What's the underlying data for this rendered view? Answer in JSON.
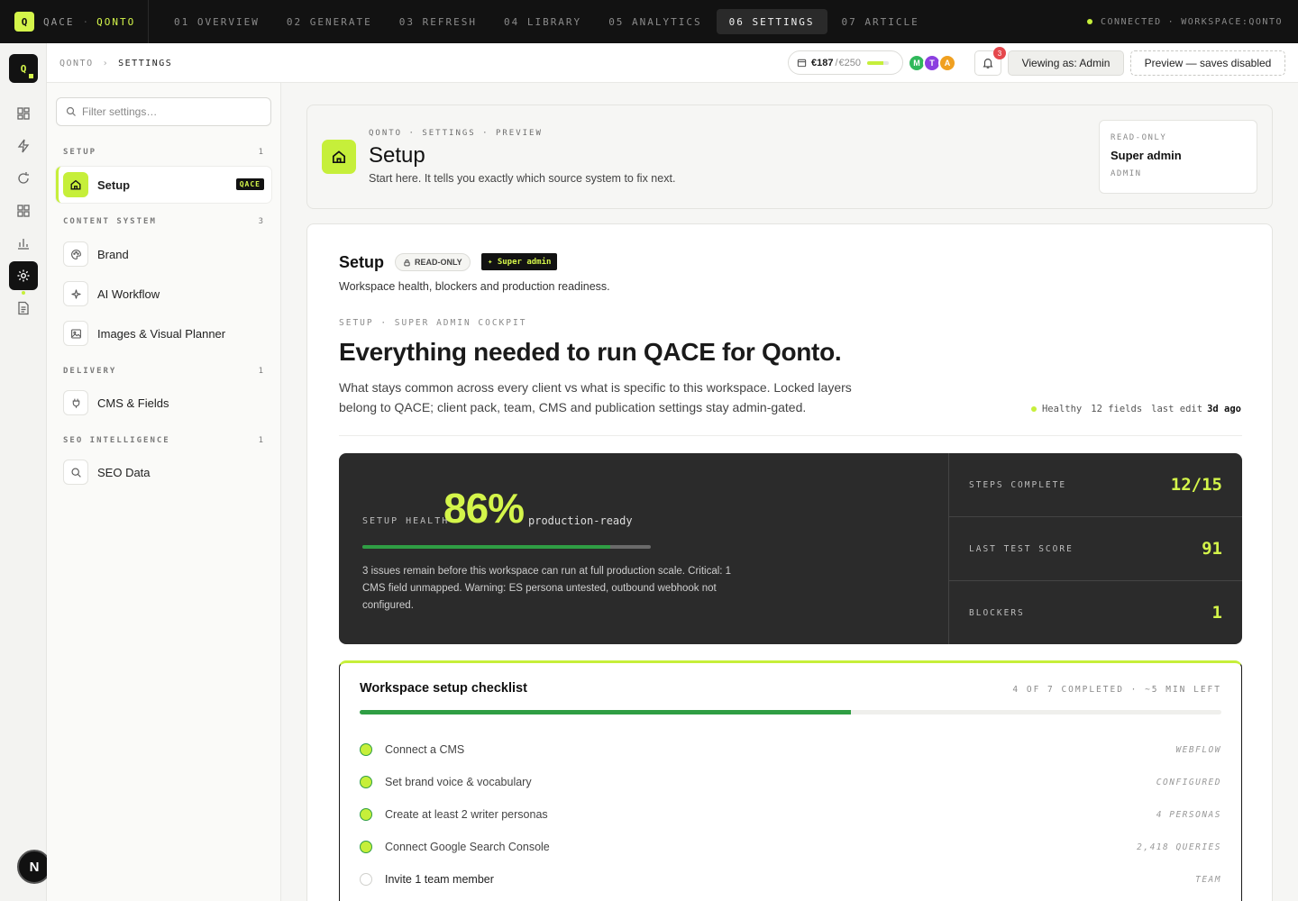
{
  "topbar": {
    "logo_letter": "Q",
    "product": "QACE",
    "separator": "·",
    "workspace": "QONTO",
    "tabs": [
      {
        "label": "01 OVERVIEW"
      },
      {
        "label": "02 GENERATE"
      },
      {
        "label": "03 REFRESH"
      },
      {
        "label": "04 LIBRARY"
      },
      {
        "label": "05 ANALYTICS"
      },
      {
        "label": "06 SETTINGS",
        "active": true
      },
      {
        "label": "07 ARTICLE"
      }
    ],
    "status": "CONNECTED",
    "status_sep": "·",
    "workspace_status": "WORKSPACE:QONTO"
  },
  "rail": {
    "logo_letter": "Q",
    "icons": [
      "overview-icon",
      "generate-icon",
      "refresh-icon",
      "library-icon",
      "analytics-icon",
      "settings-icon",
      "article-icon"
    ],
    "user_initial": "N"
  },
  "header": {
    "breadcrumb": [
      "QONTO",
      "SETTINGS"
    ],
    "breadcrumb_sep": "›",
    "budget": {
      "spent": "€187",
      "sep": "/",
      "limit": "€250",
      "fraction": 0.75
    },
    "avatars": [
      {
        "initial": "M",
        "color": "#2fb85a"
      },
      {
        "initial": "T",
        "color": "#8b3fe0"
      },
      {
        "initial": "A",
        "color": "#f0a020"
      }
    ],
    "notifications": "3",
    "viewing_as": "Viewing as: Admin",
    "preview": "Preview — saves disabled"
  },
  "sidebar": {
    "filter_placeholder": "Filter settings…",
    "sections": [
      {
        "title": "SETUP",
        "count": "1",
        "items": [
          {
            "label": "Setup",
            "tag": "QACE",
            "active": true,
            "icon": "home-icon"
          }
        ]
      },
      {
        "title": "CONTENT SYSTEM",
        "count": "3",
        "items": [
          {
            "label": "Brand",
            "icon": "palette-icon"
          },
          {
            "label": "AI Workflow",
            "icon": "sparkle-icon"
          },
          {
            "label": "Images & Visual Planner",
            "icon": "image-icon"
          }
        ]
      },
      {
        "title": "DELIVERY",
        "count": "1",
        "items": [
          {
            "label": "CMS & Fields",
            "icon": "plug-icon"
          }
        ]
      },
      {
        "title": "SEO INTELLIGENCE",
        "count": "1",
        "items": [
          {
            "label": "SEO Data",
            "icon": "search-icon"
          }
        ]
      }
    ]
  },
  "pagehead": {
    "breadcrumb": "QONTO · SETTINGS · PREVIEW",
    "title": "Setup",
    "subtitle": "Start here. It tells you exactly which source system to fix next.",
    "role_card": {
      "label": "READ-ONLY",
      "value": "Super admin",
      "role": "ADMIN"
    }
  },
  "main": {
    "title": "Setup",
    "readonly_pill": "READ-ONLY",
    "superadmin_pill": "✦ Super admin",
    "subtitle": "Workspace health, blockers and production readiness.",
    "overline": "SETUP · SUPER ADMIN COCKPIT",
    "headline": "Everything needed to run QACE for Qonto.",
    "description": "What stays common across every client vs what is specific to this workspace. Locked layers belong to QACE; client pack, team, CMS and publication settings stay admin-gated.",
    "meta": {
      "health": "Healthy",
      "fields": "12 fields",
      "last_edit_label": "last edit",
      "last_edit_value": "3d ago"
    },
    "health": {
      "label": "SETUP HEALTH",
      "percent": "86%",
      "fraction": 0.86,
      "status": "production-ready",
      "description": "3 issues remain before this workspace can run at full production scale. Critical: 1 CMS field unmapped. Warning: ES persona untested, outbound webhook not configured.",
      "stats": [
        {
          "label": "STEPS COMPLETE",
          "value": "12/15"
        },
        {
          "label": "LAST TEST SCORE",
          "value": "91"
        },
        {
          "label": "BLOCKERS",
          "value": "1"
        }
      ]
    },
    "checklist": {
      "title": "Workspace setup checklist",
      "meta": "4 OF 7 COMPLETED · ~5 MIN LEFT",
      "fraction": 0.57,
      "items": [
        {
          "label": "Connect a CMS",
          "tag": "WEBFLOW",
          "done": true
        },
        {
          "label": "Set brand voice & vocabulary",
          "tag": "CONFIGURED",
          "done": true
        },
        {
          "label": "Create at least 2 writer personas",
          "tag": "4 PERSONAS",
          "done": true
        },
        {
          "label": "Connect Google Search Console",
          "tag": "2,418 QUERIES",
          "done": true
        },
        {
          "label": "Invite 1 team member",
          "tag": "TEAM",
          "done": false
        }
      ]
    }
  },
  "colors": {
    "accent": "#c6ef3a",
    "accent_text": "#d4f54a",
    "progress": "#2f9e44",
    "dark": "#121212"
  }
}
